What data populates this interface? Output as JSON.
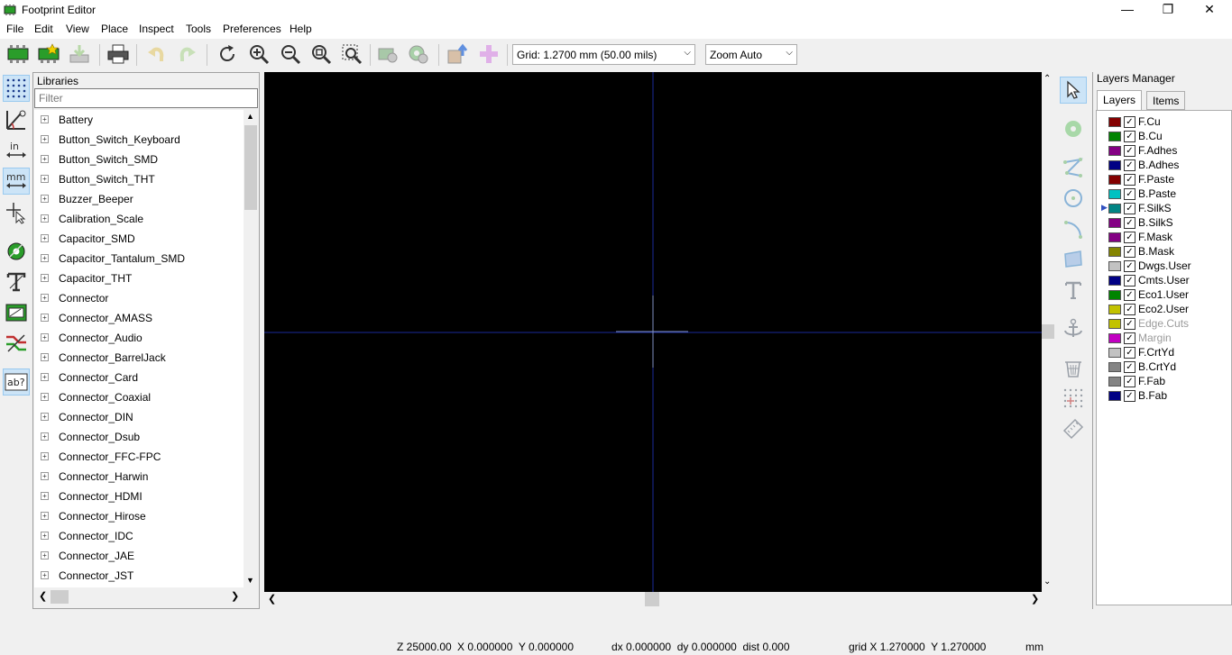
{
  "window": {
    "title": "Footprint Editor",
    "minimize": "—",
    "maximize": "❐",
    "close": "✕"
  },
  "menu": [
    "File",
    "Edit",
    "View",
    "Place",
    "Inspect",
    "Tools",
    "Preferences",
    "Help"
  ],
  "toolbar": {
    "grid_select": "Grid: 1.2700 mm (50.00 mils)",
    "zoom_select": "Zoom Auto"
  },
  "left_tools": {
    "in_label": "in",
    "mm_label": "mm",
    "ab_label": "ab?"
  },
  "libraries": {
    "caption": "Libraries",
    "filter_placeholder": "Filter",
    "items": [
      "Battery",
      "Button_Switch_Keyboard",
      "Button_Switch_SMD",
      "Button_Switch_THT",
      "Buzzer_Beeper",
      "Calibration_Scale",
      "Capacitor_SMD",
      "Capacitor_Tantalum_SMD",
      "Capacitor_THT",
      "Connector",
      "Connector_AMASS",
      "Connector_Audio",
      "Connector_BarrelJack",
      "Connector_Card",
      "Connector_Coaxial",
      "Connector_DIN",
      "Connector_Dsub",
      "Connector_FFC-FPC",
      "Connector_Harwin",
      "Connector_HDMI",
      "Connector_Hirose",
      "Connector_IDC",
      "Connector_JAE",
      "Connector_JST"
    ]
  },
  "layers_manager": {
    "caption": "Layers Manager",
    "tabs": [
      "Layers",
      "Items"
    ],
    "layers": [
      {
        "name": "F.Cu",
        "color": "#840000",
        "enabled": true
      },
      {
        "name": "B.Cu",
        "color": "#008400",
        "enabled": true
      },
      {
        "name": "F.Adhes",
        "color": "#840084",
        "enabled": true
      },
      {
        "name": "B.Adhes",
        "color": "#000084",
        "enabled": true
      },
      {
        "name": "F.Paste",
        "color": "#840000",
        "enabled": true
      },
      {
        "name": "B.Paste",
        "color": "#00c2c2",
        "enabled": true
      },
      {
        "name": "F.SilkS",
        "color": "#008484",
        "enabled": true,
        "active": true
      },
      {
        "name": "B.SilkS",
        "color": "#840084",
        "enabled": true
      },
      {
        "name": "F.Mask",
        "color": "#840084",
        "enabled": true
      },
      {
        "name": "B.Mask",
        "color": "#848400",
        "enabled": true
      },
      {
        "name": "Dwgs.User",
        "color": "#c2c2c2",
        "enabled": true
      },
      {
        "name": "Cmts.User",
        "color": "#000084",
        "enabled": true
      },
      {
        "name": "Eco1.User",
        "color": "#008400",
        "enabled": true
      },
      {
        "name": "Eco2.User",
        "color": "#c2c200",
        "enabled": true
      },
      {
        "name": "Edge.Cuts",
        "color": "#c2c200",
        "enabled": true,
        "dimmed": true
      },
      {
        "name": "Margin",
        "color": "#c200c2",
        "enabled": true,
        "dimmed": true
      },
      {
        "name": "F.CrtYd",
        "color": "#c2c2c2",
        "enabled": true
      },
      {
        "name": "B.CrtYd",
        "color": "#848484",
        "enabled": true
      },
      {
        "name": "F.Fab",
        "color": "#848484",
        "enabled": true
      },
      {
        "name": "B.Fab",
        "color": "#000084",
        "enabled": true
      }
    ]
  },
  "status": {
    "zoom": "Z 25000.00",
    "xy": "X 0.000000  Y 0.000000",
    "delta": "dx 0.000000  dy 0.000000  dist 0.000",
    "grid": "grid X 1.270000  Y 1.270000",
    "units": "mm"
  }
}
